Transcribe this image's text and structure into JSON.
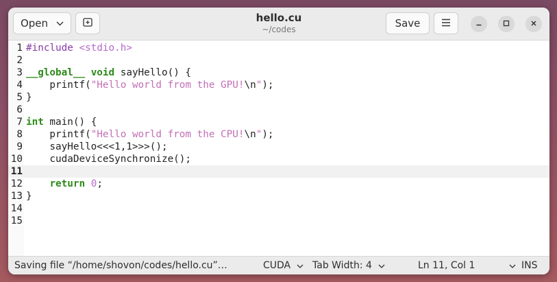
{
  "header": {
    "open_label": "Open",
    "save_label": "Save",
    "title": "hello.cu",
    "subtitle": "~/codes"
  },
  "editor": {
    "current_line": 11,
    "lines": [
      {
        "n": "1",
        "tokens": [
          {
            "t": "#include ",
            "c": "pp"
          },
          {
            "t": "<stdio.h>",
            "c": "inc"
          }
        ]
      },
      {
        "n": "2",
        "tokens": []
      },
      {
        "n": "3",
        "tokens": [
          {
            "t": "__global__",
            "c": "kw"
          },
          {
            "t": " ",
            "c": ""
          },
          {
            "t": "void",
            "c": "kw"
          },
          {
            "t": " sayHello() {",
            "c": ""
          }
        ]
      },
      {
        "n": "4",
        "tokens": [
          {
            "t": "    printf(",
            "c": ""
          },
          {
            "t": "\"Hello world from the GPU!",
            "c": "str"
          },
          {
            "t": "\\n",
            "c": ""
          },
          {
            "t": "\"",
            "c": "str"
          },
          {
            "t": ");",
            "c": ""
          }
        ]
      },
      {
        "n": "5",
        "tokens": [
          {
            "t": "}",
            "c": ""
          }
        ]
      },
      {
        "n": "6",
        "tokens": []
      },
      {
        "n": "7",
        "tokens": [
          {
            "t": "int",
            "c": "kw"
          },
          {
            "t": " main() {",
            "c": ""
          }
        ]
      },
      {
        "n": "8",
        "tokens": [
          {
            "t": "    printf(",
            "c": ""
          },
          {
            "t": "\"Hello world from the CPU!",
            "c": "str"
          },
          {
            "t": "\\n",
            "c": ""
          },
          {
            "t": "\"",
            "c": "str"
          },
          {
            "t": ");",
            "c": ""
          }
        ]
      },
      {
        "n": "9",
        "tokens": [
          {
            "t": "    sayHello<<<1,1>>>();",
            "c": ""
          }
        ]
      },
      {
        "n": "10",
        "tokens": [
          {
            "t": "    cudaDeviceSynchronize();",
            "c": ""
          }
        ]
      },
      {
        "n": "11",
        "tokens": []
      },
      {
        "n": "12",
        "tokens": [
          {
            "t": "    ",
            "c": ""
          },
          {
            "t": "return",
            "c": "kw"
          },
          {
            "t": " ",
            "c": ""
          },
          {
            "t": "0",
            "c": "num"
          },
          {
            "t": ";",
            "c": ""
          }
        ]
      },
      {
        "n": "13",
        "tokens": [
          {
            "t": "}",
            "c": ""
          }
        ]
      },
      {
        "n": "14",
        "tokens": []
      },
      {
        "n": "15",
        "tokens": []
      }
    ]
  },
  "status": {
    "message": "Saving file “/home/shovon/codes/hello.cu”…",
    "language": "CUDA",
    "tab_width": "Tab Width: 4",
    "position": "Ln 11, Col 1",
    "mode": "INS"
  },
  "icons": {
    "open_chevron": "chevron-down-icon",
    "new_tab": "new-tab-icon",
    "menu": "hamburger-menu-icon",
    "minimize": "minimize-icon",
    "maximize": "maximize-icon",
    "close": "close-icon"
  },
  "colors": {
    "keyword": "#2d8a1a",
    "string": "#c26fb6",
    "preprocessor": "#8a3ba6",
    "current_line_bg": "#f1f1f1"
  }
}
